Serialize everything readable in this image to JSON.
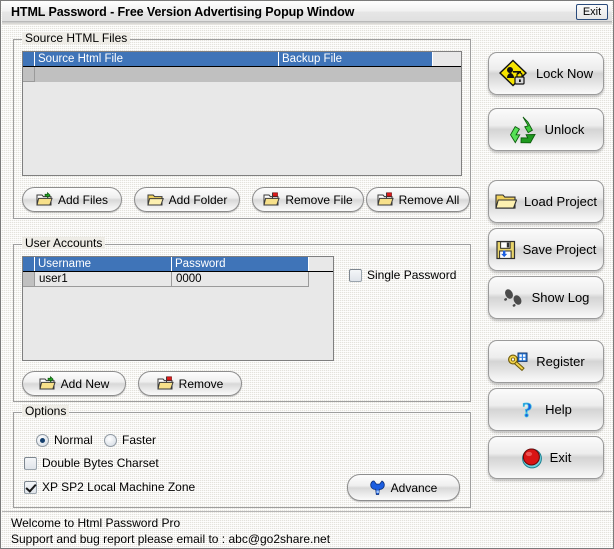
{
  "window": {
    "title": "HTML Password  - Free Version Advertising Popup Window",
    "exit_label": "Exit"
  },
  "source_files": {
    "group_title": "Source HTML Files",
    "columns": [
      "Source Html File",
      "Backup File"
    ],
    "rows": [],
    "buttons": [
      {
        "label": "Add Files",
        "icon": "folder-add-icon"
      },
      {
        "label": "Add Folder",
        "icon": "folder-open-icon"
      },
      {
        "label": "Remove File",
        "icon": "folder-remove-icon"
      },
      {
        "label": "Remove All",
        "icon": "folder-remove-all-icon"
      }
    ]
  },
  "user_accounts": {
    "group_title": "User Accounts",
    "columns": [
      "Username",
      "Password"
    ],
    "rows": [
      {
        "username": "user1",
        "password": "0000"
      }
    ],
    "single_password": {
      "label": "Single Password",
      "checked": false
    },
    "buttons": [
      {
        "label": "Add New",
        "icon": "folder-add-icon"
      },
      {
        "label": "Remove",
        "icon": "folder-remove-icon"
      }
    ]
  },
  "options": {
    "group_title": "Options",
    "speed_mode": [
      {
        "label": "Normal",
        "selected": true
      },
      {
        "label": "Faster",
        "selected": false
      }
    ],
    "double_bytes_charset": {
      "label": "Double Bytes Charset",
      "checked": false
    },
    "xp_sp2_zone": {
      "label": "XP SP2 Local Machine Zone",
      "checked": true
    },
    "advance_button": {
      "label": "Advance",
      "icon": "wrench-icon"
    }
  },
  "sidebar": {
    "buttons": [
      {
        "label": "Lock Now",
        "icon": "lock-sign-icon"
      },
      {
        "label": "Unlock",
        "icon": "recycle-icon"
      },
      {
        "label": "Load Project",
        "icon": "folder-open-icon"
      },
      {
        "label": "Save Project",
        "icon": "floppy-disk-icon"
      },
      {
        "label": "Show Log",
        "icon": "footprints-icon"
      },
      {
        "label": "Register",
        "icon": "key-icon"
      },
      {
        "label": "Help",
        "icon": "question-mark-icon"
      },
      {
        "label": "Exit",
        "icon": "power-button-icon"
      }
    ]
  },
  "status": {
    "line1": "Welcome to Html Password Pro",
    "line2": "Support and bug report please email to : abc@go2share.net"
  },
  "colors": {
    "header_blue": "#3f74b8",
    "panel_bg": "#eceae4",
    "list_bg": "#e8e8e8"
  }
}
